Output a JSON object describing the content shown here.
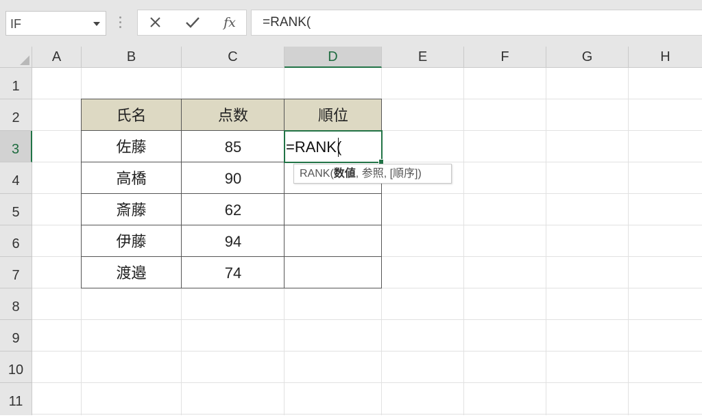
{
  "formula_bar": {
    "name_box": "IF",
    "fx_label": "fx",
    "formula": "=RANK("
  },
  "columns": [
    "A",
    "B",
    "C",
    "D",
    "E",
    "F",
    "G",
    "H"
  ],
  "rows": [
    "1",
    "2",
    "3",
    "4",
    "5",
    "6",
    "7",
    "8",
    "9",
    "10",
    "11"
  ],
  "table": {
    "headers": [
      "氏名",
      "点数",
      "順位"
    ],
    "rows": [
      {
        "name": "佐藤",
        "score": "85"
      },
      {
        "name": "高橋",
        "score": "90"
      },
      {
        "name": "斎藤",
        "score": "62"
      },
      {
        "name": "伊藤",
        "score": "94"
      },
      {
        "name": "渡邉",
        "score": "74"
      }
    ]
  },
  "active_cell": {
    "ref": "D3",
    "content": "=RANK("
  },
  "tooltip": {
    "func": "RANK(",
    "arg1": "数値",
    "rest": ", 参照, [順序])"
  },
  "colors": {
    "accent": "#217346",
    "header_fill": "#ddd9c3",
    "chrome": "#e6e6e6"
  }
}
